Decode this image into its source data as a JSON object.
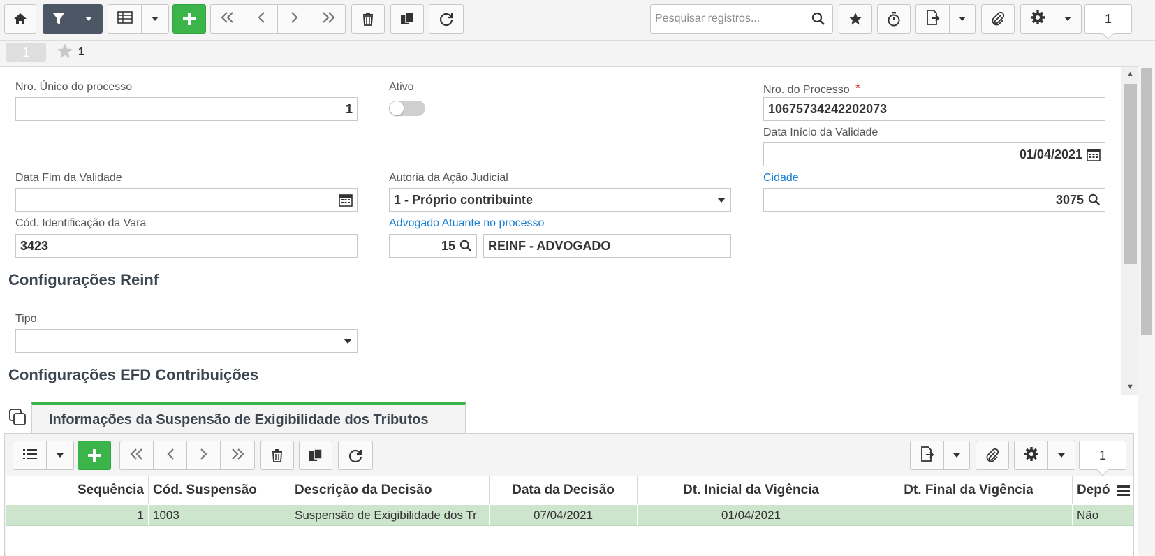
{
  "toolbar": {
    "search_placeholder": "Pesquisar registros...",
    "record_counter": "1",
    "icons": [
      "home-icon",
      "filter-icon",
      "grid-view-icon",
      "add-icon",
      "first-icon",
      "prev-icon",
      "next-icon",
      "last-icon",
      "delete-icon",
      "copy-icon",
      "refresh-icon",
      "search-icon",
      "star-icon",
      "timer-icon",
      "export-icon",
      "attach-icon",
      "gear-icon"
    ]
  },
  "subbar": {
    "record_pill": "1",
    "favorite_count": "1"
  },
  "form": {
    "nro_unico_label": "Nro. Único do processo",
    "nro_unico_value": "1",
    "ativo_label": "Ativo",
    "ativo_on": false,
    "nro_processo_label": "Nro. do Processo",
    "nro_processo_required": "*",
    "nro_processo_value": "10675734242202073",
    "data_inicio_label": "Data Início da Validade",
    "data_inicio_value": "01/04/2021",
    "data_fim_label": "Data Fim da Validade",
    "data_fim_value": "",
    "autoria_label": "Autoria da Ação Judicial",
    "autoria_value": "1 - Próprio contribuinte",
    "cidade_label": "Cidade",
    "cidade_value": "3075",
    "cod_vara_label": "Cód. Identificação da Vara",
    "cod_vara_value": "3423",
    "advogado_label": "Advogado Atuante no processo",
    "advogado_code": "15",
    "advogado_name": "REINF - ADVOGADO",
    "section_reinf": "Configurações Reinf",
    "tipo_label": "Tipo",
    "tipo_value": "",
    "section_efd": "Configurações EFD Contribuições"
  },
  "detail": {
    "tab_label": "Informações da Suspensão de Exigibilidade dos Tributos",
    "record_counter": "1",
    "columns": [
      "Sequência",
      "Cód. Suspensão",
      "Descrição da Decisão",
      "Data da Decisão",
      "Dt. Inicial da Vigência",
      "Dt. Final da Vigência",
      "Depó"
    ],
    "rows": [
      [
        "1",
        "1003",
        "Suspensão de Exigibilidade dos Tr",
        "07/04/2021",
        "01/04/2021",
        "",
        "Não"
      ]
    ]
  },
  "colors": {
    "accent_green": "#3bb54a",
    "link_blue": "#1a7fd4",
    "required_red": "#d9332b",
    "selected_row": "#cde5cd",
    "dark_button": "#4b5765"
  }
}
